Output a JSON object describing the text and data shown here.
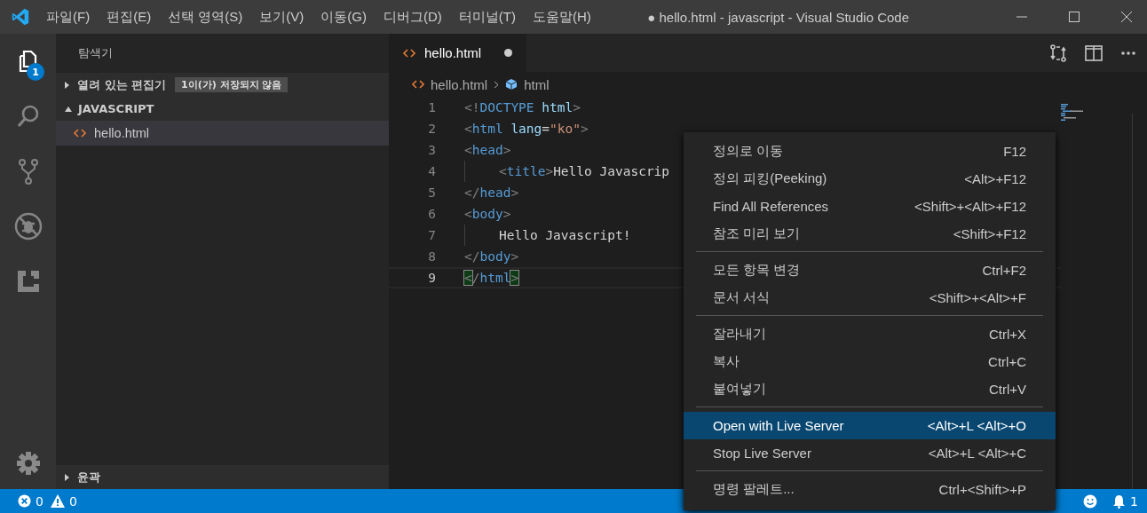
{
  "window": {
    "title": "● hello.html - javascript - Visual Studio Code"
  },
  "menu_bar": [
    "파일(F)",
    "편집(E)",
    "선택 영역(S)",
    "보기(V)",
    "이동(G)",
    "디버그(D)",
    "터미널(T)",
    "도움말(H)"
  ],
  "activity_bar": [
    {
      "kind": "explorer",
      "selected": true,
      "badge": "1"
    },
    {
      "kind": "search",
      "selected": false
    },
    {
      "kind": "source-control",
      "selected": false
    },
    {
      "kind": "debug",
      "selected": false
    },
    {
      "kind": "extensions",
      "selected": false
    }
  ],
  "sidebar": {
    "title": "탐색기",
    "sections": [
      {
        "label": "열려 있는 편집기",
        "expanded": false,
        "badge": "1이(가) 저장되지 않음"
      },
      {
        "label": "JAVASCRIPT",
        "expanded": true,
        "files": [
          {
            "name": "hello.html",
            "selected": true
          }
        ]
      }
    ],
    "bottom_section": {
      "label": "윤곽",
      "expanded": false
    }
  },
  "tabs": [
    {
      "label": "hello.html",
      "selected": true,
      "dirty": true
    }
  ],
  "breadcrumb": [
    "hello.html",
    "html"
  ],
  "code_lines": [
    {
      "number": "1",
      "indent": false,
      "current": false,
      "tokens": [
        {
          "text": "<!",
          "kind": "punct"
        },
        {
          "text": "DOCTYPE",
          "kind": "tag"
        },
        {
          "text": " html",
          "kind": "attr"
        },
        {
          "text": ">",
          "kind": "punct"
        }
      ]
    },
    {
      "number": "2",
      "indent": false,
      "current": false,
      "tokens": [
        {
          "text": "<",
          "kind": "punct"
        },
        {
          "text": "html",
          "kind": "tag"
        },
        {
          "text": " lang",
          "kind": "attr"
        },
        {
          "text": "=",
          "kind": "text"
        },
        {
          "text": "\"ko\"",
          "kind": "string"
        },
        {
          "text": ">",
          "kind": "punct"
        }
      ]
    },
    {
      "number": "3",
      "indent": false,
      "current": false,
      "tokens": [
        {
          "text": "<",
          "kind": "punct"
        },
        {
          "text": "head",
          "kind": "tag"
        },
        {
          "text": ">",
          "kind": "punct"
        }
      ]
    },
    {
      "number": "4",
      "indent": true,
      "current": false,
      "tokens": [
        {
          "text": "<",
          "kind": "punct"
        },
        {
          "text": "title",
          "kind": "tag"
        },
        {
          "text": ">",
          "kind": "punct"
        },
        {
          "text": "Hello Javascrip",
          "kind": "text"
        }
      ]
    },
    {
      "number": "5",
      "indent": false,
      "current": false,
      "tokens": [
        {
          "text": "</",
          "kind": "punct"
        },
        {
          "text": "head",
          "kind": "tag"
        },
        {
          "text": ">",
          "kind": "punct"
        }
      ]
    },
    {
      "number": "6",
      "indent": false,
      "current": false,
      "tokens": [
        {
          "text": "<",
          "kind": "punct"
        },
        {
          "text": "body",
          "kind": "tag"
        },
        {
          "text": ">",
          "kind": "punct"
        }
      ]
    },
    {
      "number": "7",
      "indent": true,
      "current": false,
      "tokens": [
        {
          "text": "Hello Javascript!",
          "kind": "text"
        }
      ]
    },
    {
      "number": "8",
      "indent": false,
      "current": false,
      "tokens": [
        {
          "text": "</",
          "kind": "punct"
        },
        {
          "text": "body",
          "kind": "tag"
        },
        {
          "text": ">",
          "kind": "punct"
        }
      ]
    },
    {
      "number": "9",
      "indent": false,
      "current": true,
      "tokens": [
        {
          "text": "<",
          "kind": "match"
        },
        {
          "text": "/",
          "kind": "punct"
        },
        {
          "text": "html",
          "kind": "tag"
        },
        {
          "text": ">",
          "kind": "match"
        }
      ]
    }
  ],
  "context_menu": [
    [
      {
        "label": "정의로 이동",
        "shortcut": "F12",
        "selected": false
      },
      {
        "label": "정의 피킹(Peeking)",
        "shortcut": "<Alt>+F12",
        "selected": false
      },
      {
        "label": "Find All References",
        "shortcut": "<Shift>+<Alt>+F12",
        "selected": false
      },
      {
        "label": "참조 미리 보기",
        "shortcut": "<Shift>+F12",
        "selected": false
      }
    ],
    [
      {
        "label": "모든 항목 변경",
        "shortcut": "Ctrl+F2",
        "selected": false
      },
      {
        "label": "문서 서식",
        "shortcut": "<Shift>+<Alt>+F",
        "selected": false
      }
    ],
    [
      {
        "label": "잘라내기",
        "shortcut": "Ctrl+X",
        "selected": false
      },
      {
        "label": "복사",
        "shortcut": "Ctrl+C",
        "selected": false
      },
      {
        "label": "붙여넣기",
        "shortcut": "Ctrl+V",
        "selected": false
      }
    ],
    [
      {
        "label": "Open with Live Server",
        "shortcut": "<Alt>+L <Alt>+O",
        "selected": true
      },
      {
        "label": "Stop Live Server",
        "shortcut": "<Alt>+L <Alt>+C",
        "selected": false
      }
    ],
    [
      {
        "label": "명령 팔레트...",
        "shortcut": "Ctrl+<Shift>+P",
        "selected": false
      }
    ]
  ],
  "status_bar": {
    "errors": "0",
    "warnings": "0",
    "notifications": "1"
  }
}
